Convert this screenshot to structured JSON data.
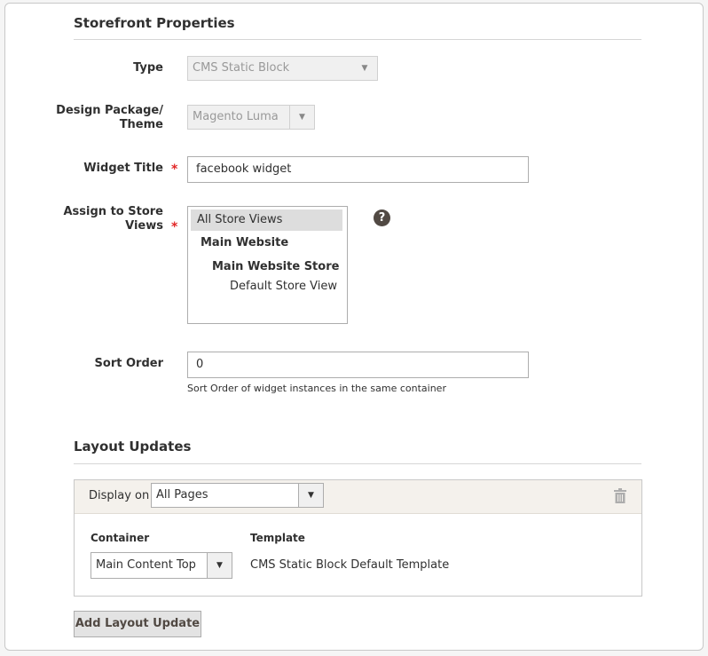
{
  "storefront": {
    "title": "Storefront Properties",
    "type_label": "Type",
    "type_value": "CMS Static Block",
    "theme_label_line1": "Design Package/",
    "theme_label_line2": "Theme",
    "theme_value": "Magento Luma",
    "widget_title_label": "Widget Title",
    "widget_title_value": "facebook widget",
    "store_views_label_line1": "Assign to Store",
    "store_views_label_line2": "Views",
    "store_views": {
      "all": "All Store Views",
      "website": "Main Website",
      "store": "Main Website Store",
      "view": "Default Store View"
    },
    "help_symbol": "?",
    "sort_order_label": "Sort Order",
    "sort_order_value": "0",
    "sort_order_note": "Sort Order of widget instances in the same container",
    "required_marker": "*"
  },
  "layout": {
    "title": "Layout Updates",
    "display_on_label": "Display on",
    "display_on_value": "All Pages",
    "container_label": "Container",
    "container_value": "Main Content Top",
    "template_label": "Template",
    "template_value": "CMS Static Block Default Template",
    "add_button_label": "Add Layout Update"
  },
  "icons": {
    "dropdown": "chevron-down-icon",
    "help": "question-circle-icon",
    "delete": "trash-icon"
  }
}
